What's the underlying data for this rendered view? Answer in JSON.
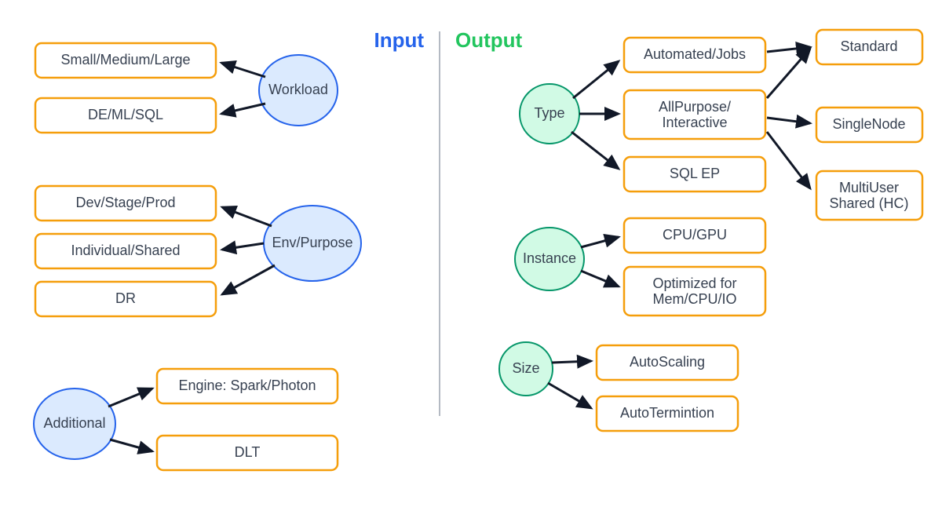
{
  "headers": {
    "input": "Input",
    "output": "Output"
  },
  "input": {
    "workload": {
      "label": "Workload",
      "items": [
        "Small/Medium/Large",
        "DE/ML/SQL"
      ]
    },
    "env": {
      "label": "Env/Purpose",
      "items": [
        "Dev/Stage/Prod",
        "Individual/Shared",
        "DR"
      ]
    },
    "additional": {
      "label": "Additional",
      "items": [
        "Engine: Spark/Photon",
        "DLT"
      ]
    }
  },
  "output": {
    "type": {
      "label": "Type",
      "items": [
        "Automated/Jobs",
        "AllPurpose/\nInteractive",
        "SQL EP"
      ],
      "sub": [
        "Standard",
        "SingleNode",
        "MultiUser\nShared (HC)"
      ]
    },
    "instance": {
      "label": "Instance",
      "items": [
        "CPU/GPU",
        "Optimized for\nMem/CPU/IO"
      ]
    },
    "size": {
      "label": "Size",
      "items": [
        "AutoScaling",
        "AutoTermintion"
      ]
    }
  }
}
